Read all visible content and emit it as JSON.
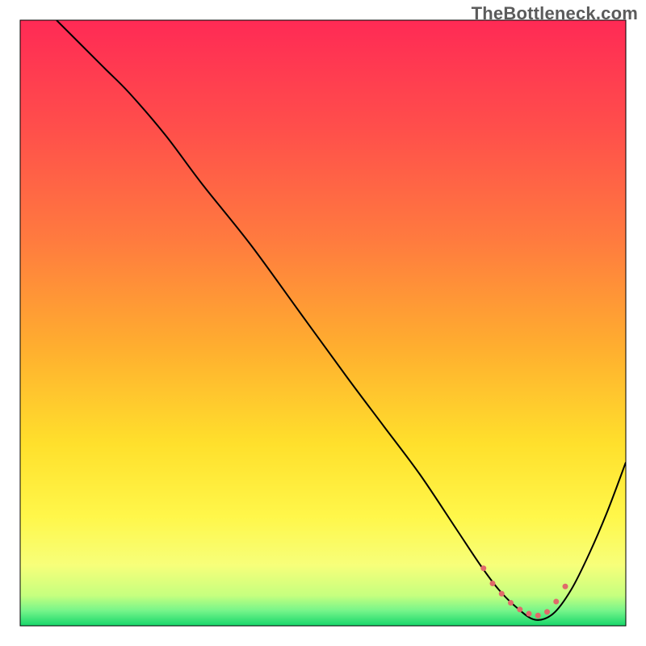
{
  "watermark": "TheBottleneck.com",
  "chart_data": {
    "type": "line",
    "title": "",
    "xlabel": "",
    "ylabel": "",
    "xlim": [
      0,
      100
    ],
    "ylim": [
      0,
      100
    ],
    "grid": false,
    "legend": false,
    "background_gradient": {
      "stops": [
        {
          "offset": 0.0,
          "color": "#ff2a55"
        },
        {
          "offset": 0.18,
          "color": "#ff4f4b"
        },
        {
          "offset": 0.36,
          "color": "#ff7a3f"
        },
        {
          "offset": 0.54,
          "color": "#ffae2f"
        },
        {
          "offset": 0.7,
          "color": "#ffe02c"
        },
        {
          "offset": 0.82,
          "color": "#fff74a"
        },
        {
          "offset": 0.9,
          "color": "#f7ff7a"
        },
        {
          "offset": 0.95,
          "color": "#c6ff7f"
        },
        {
          "offset": 0.975,
          "color": "#76f58a"
        },
        {
          "offset": 1.0,
          "color": "#16d66a"
        }
      ]
    },
    "series": [
      {
        "name": "bottleneck-curve",
        "color": "#000000",
        "stroke_width": 2,
        "x": [
          6,
          10,
          14,
          18,
          24,
          30,
          38,
          46,
          54,
          60,
          66,
          72,
          76,
          79,
          82,
          85,
          88,
          91,
          94,
          97,
          100
        ],
        "y": [
          100,
          96,
          92,
          88,
          81,
          73,
          63,
          52,
          41,
          33,
          25,
          16,
          10,
          6,
          3,
          1,
          2,
          6,
          12,
          19,
          27
        ]
      },
      {
        "name": "optimal-band",
        "color": "#e06a6a",
        "stroke_width": 7,
        "style": "dotted",
        "x": [
          76.5,
          78,
          79.5,
          81,
          82.5,
          84,
          85.5,
          87,
          88.5,
          90
        ],
        "y": [
          9.5,
          7.0,
          5.3,
          3.8,
          2.7,
          2.0,
          1.7,
          2.3,
          4.0,
          6.5
        ]
      }
    ]
  }
}
